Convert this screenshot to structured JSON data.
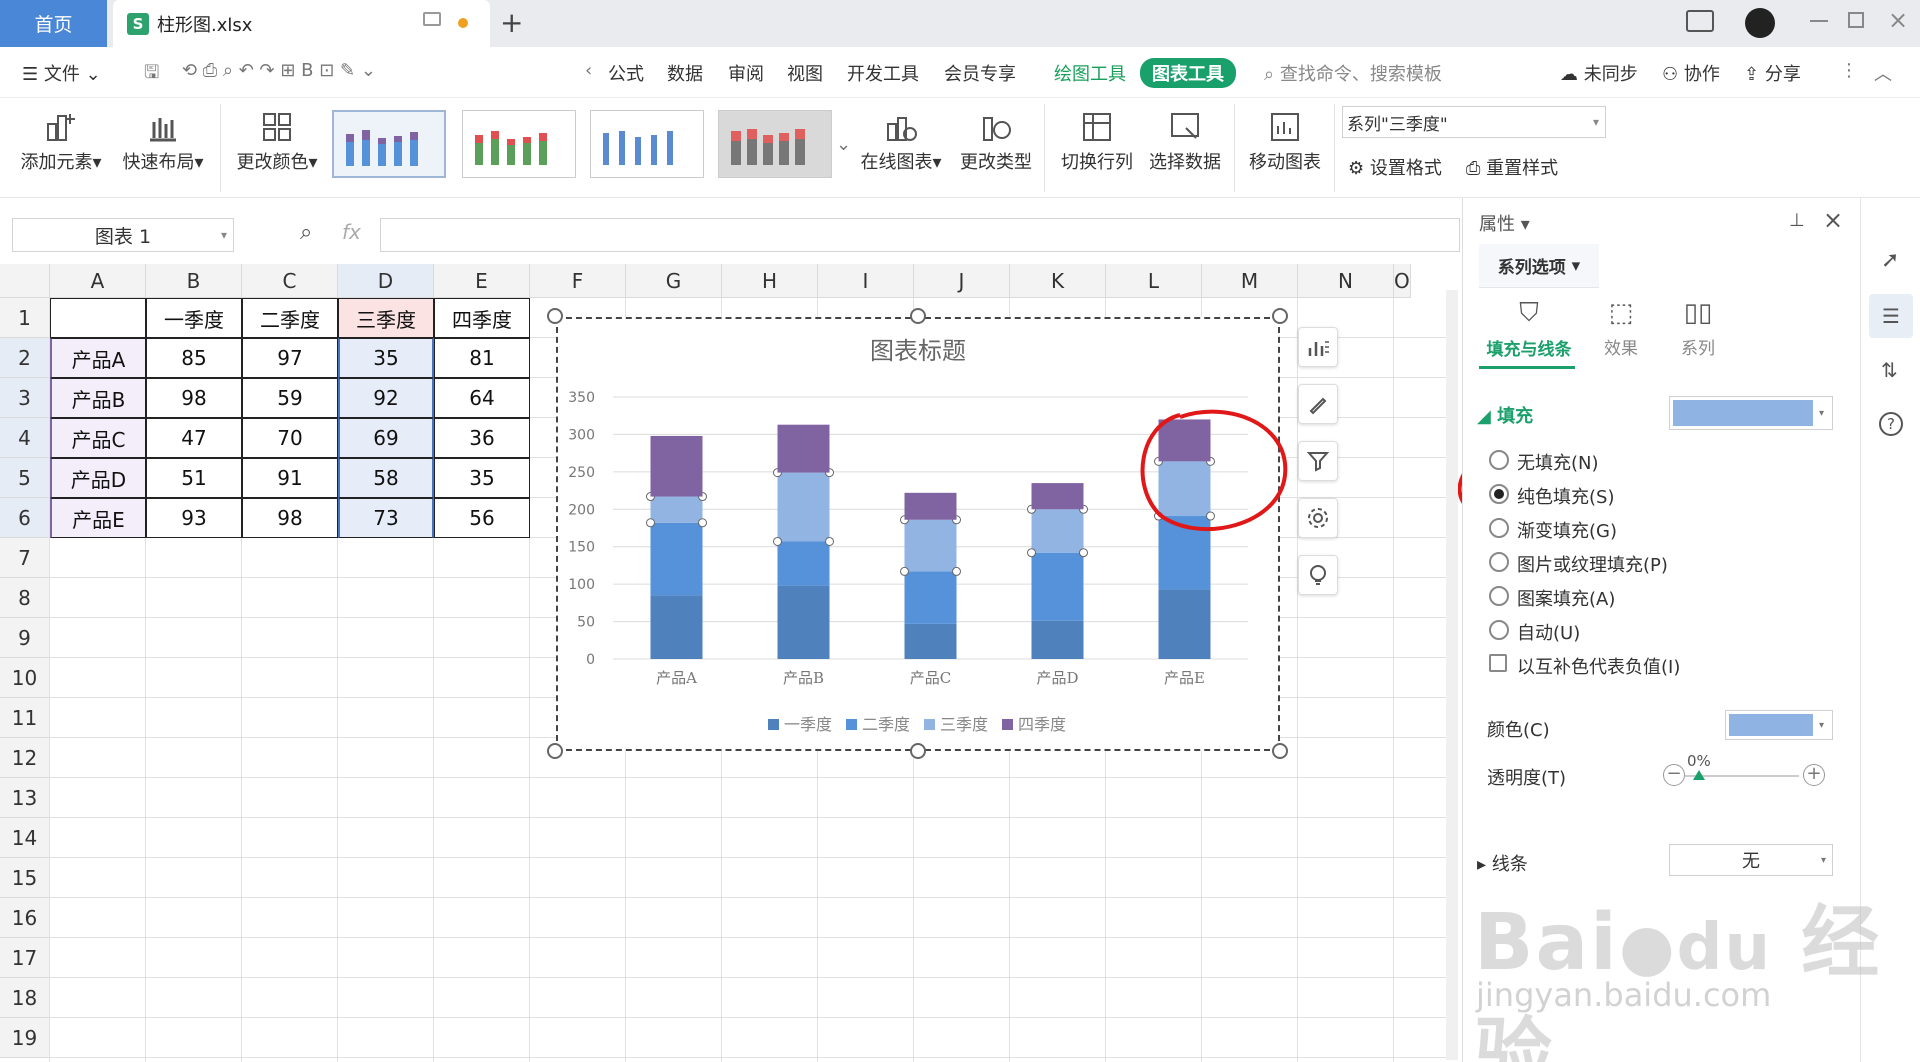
{
  "titlebar": {
    "home_tab": "首页",
    "file_tab": "柱形图.xlsx",
    "file_icon": "S"
  },
  "menu": {
    "file": "文件",
    "items": [
      "公式",
      "数据",
      "审阅",
      "视图",
      "开发工具",
      "会员专享"
    ],
    "drawing_tools": "绘图工具",
    "chart_tools": "图表工具",
    "search_placeholder": "查找命令、搜索模板",
    "sync": "未同步",
    "collab": "协作",
    "share": "分享"
  },
  "ribbon": {
    "add_element": "添加元素",
    "quick_layout": "快速布局",
    "change_color": "更改颜色",
    "online_chart": "在线图表",
    "change_type": "更改类型",
    "switch_rowcol": "切换行列",
    "select_data": "选择数据",
    "move_chart": "移动图表",
    "series_select": "系列\"三季度\"",
    "set_format": "设置格式",
    "reset_style": "重置样式"
  },
  "formula_bar": {
    "name_box": "图表 1",
    "fx": "fx"
  },
  "sheet": {
    "columns": [
      "A",
      "B",
      "C",
      "D",
      "E",
      "F",
      "G",
      "H",
      "I",
      "J",
      "K",
      "L",
      "M",
      "N",
      "O"
    ],
    "rows": [
      "1",
      "2",
      "3",
      "4",
      "5",
      "6",
      "7",
      "8",
      "9",
      "10",
      "11",
      "12",
      "13",
      "14",
      "15",
      "16",
      "17",
      "18",
      "19"
    ],
    "header_row": [
      "",
      "一季度",
      "二季度",
      "三季度",
      "四季度"
    ],
    "data": [
      [
        "产品A",
        "85",
        "97",
        "35",
        "81"
      ],
      [
        "产品B",
        "98",
        "59",
        "92",
        "64"
      ],
      [
        "产品C",
        "47",
        "70",
        "69",
        "36"
      ],
      [
        "产品D",
        "51",
        "91",
        "58",
        "35"
      ],
      [
        "产品E",
        "93",
        "98",
        "73",
        "56"
      ]
    ]
  },
  "chart_data": {
    "type": "bar",
    "stacked": true,
    "title": "图表标题",
    "categories": [
      "产品A",
      "产品B",
      "产品C",
      "产品D",
      "产品E"
    ],
    "series": [
      {
        "name": "一季度",
        "values": [
          85,
          98,
          47,
          51,
          93
        ],
        "color": "#4f81bd"
      },
      {
        "name": "二季度",
        "values": [
          97,
          59,
          70,
          91,
          98
        ],
        "color": "#5592da"
      },
      {
        "name": "三季度",
        "values": [
          35,
          92,
          69,
          58,
          73
        ],
        "color": "#92b4e3"
      },
      {
        "name": "四季度",
        "values": [
          81,
          64,
          36,
          35,
          56
        ],
        "color": "#8064a2"
      }
    ],
    "ylim": [
      0,
      350
    ],
    "yticks": [
      "0",
      "50",
      "100",
      "150",
      "200",
      "250",
      "300",
      "350"
    ],
    "grid": true,
    "legend": "bottom"
  },
  "panel": {
    "title": "属性",
    "tab": "系列选项",
    "subtabs": [
      "填充与线条",
      "效果",
      "系列"
    ],
    "fill_heading": "填充",
    "fill_options": [
      "无填充(N)",
      "纯色填充(S)",
      "渐变填充(G)",
      "图片或纹理填充(P)",
      "图案填充(A)",
      "自动(U)"
    ],
    "invert_negative": "以互补色代表负值(I)",
    "color_label": "颜色(C)",
    "transparency_label": "透明度(T)",
    "transparency_value": "0%",
    "line_heading": "线条",
    "line_value": "无",
    "fill_color": "#8fb4e3"
  },
  "watermark": {
    "brand": "Bai",
    "cn": "经验",
    "url": "jingyan.baidu.com"
  }
}
